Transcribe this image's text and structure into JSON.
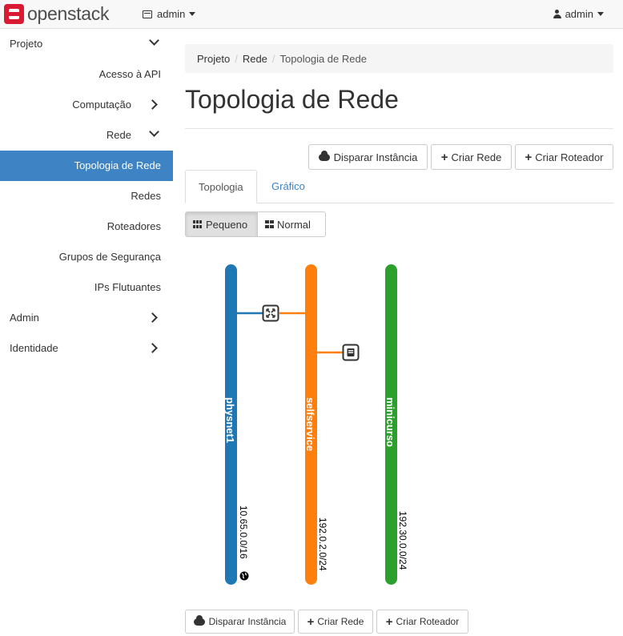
{
  "navbar": {
    "brand": "openstack",
    "project_menu_label": "admin",
    "user_menu_label": "admin"
  },
  "sidebar": {
    "items": [
      {
        "label": "Projeto"
      },
      {
        "label": "Acesso à API"
      },
      {
        "label": "Computação"
      },
      {
        "label": "Rede"
      },
      {
        "label": "Topologia de Rede"
      },
      {
        "label": "Redes"
      },
      {
        "label": "Roteadores"
      },
      {
        "label": "Grupos de Segurança"
      },
      {
        "label": "IPs Flutuantes"
      },
      {
        "label": "Admin"
      },
      {
        "label": "Identidade"
      }
    ],
    "active": "Topologia de Rede"
  },
  "breadcrumb": [
    "Projeto",
    "Rede",
    "Topologia de Rede"
  ],
  "page_title": "Topologia de Rede",
  "actions": {
    "launch_instance": "Disparar Instância",
    "create_network": "Criar Rede",
    "create_router": "Criar Roteador"
  },
  "tabs": [
    "Topologia",
    "Gráfico"
  ],
  "view_toggle": {
    "small": "Pequeno",
    "normal": "Normal",
    "selected": "Pequeno"
  },
  "topology": {
    "networks": [
      {
        "name": "physnet1",
        "cidr": "10.65.0.0/16",
        "color": "#1f77b4",
        "external": true
      },
      {
        "name": "selfservice",
        "cidr": "192.0.2.0/24",
        "color": "#ff7f0e",
        "external": false
      },
      {
        "name": "minicurso",
        "cidr": "192.30.0.0/24",
        "color": "#2ca02c",
        "external": false
      }
    ],
    "devices": [
      {
        "type": "router",
        "icon": "router-icon",
        "connects": [
          "physnet1",
          "selfservice"
        ]
      },
      {
        "type": "instance",
        "icon": "instance-icon",
        "connects": [
          "selfservice"
        ]
      }
    ]
  }
}
